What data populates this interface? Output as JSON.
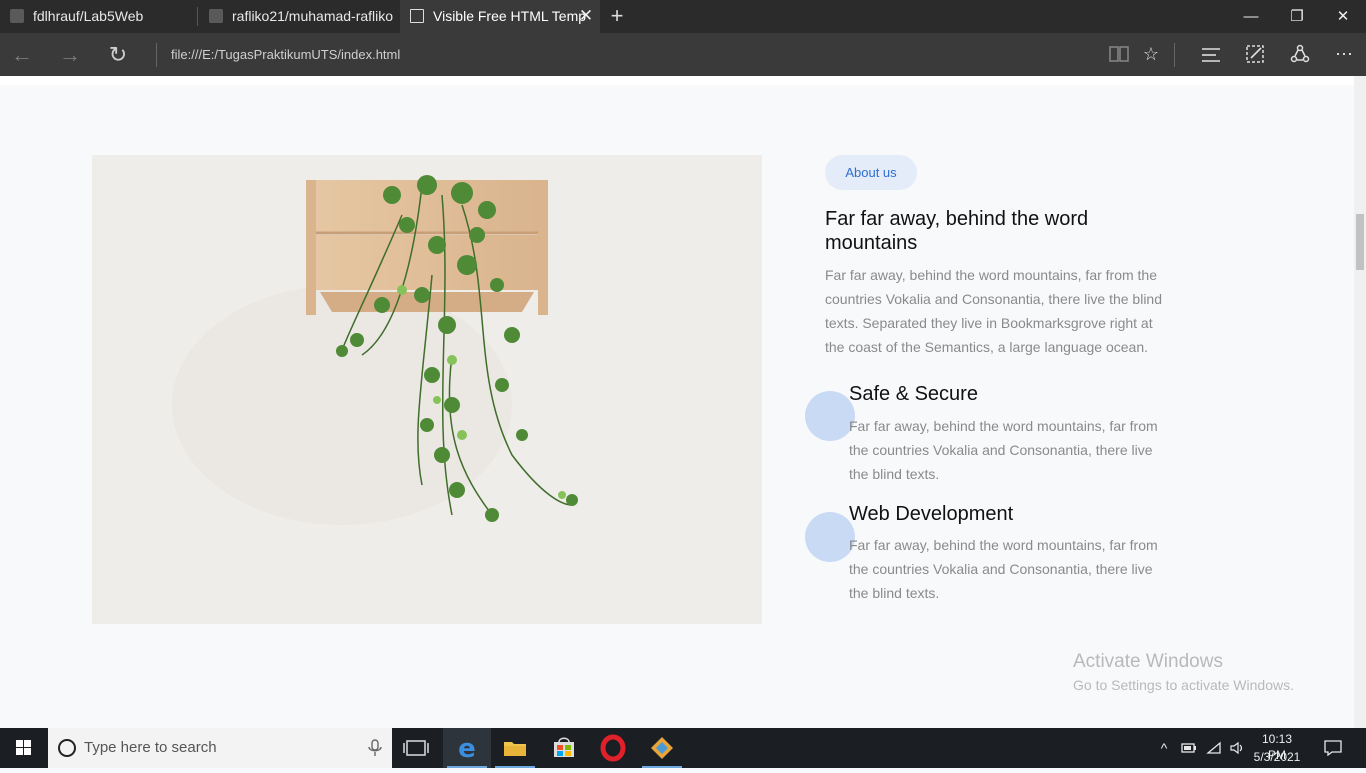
{
  "tabs": [
    {
      "title": "fdlhrauf/Lab5Web"
    },
    {
      "title": "rafliko21/muhamad-rafliko"
    },
    {
      "title": "Visible Free HTML Temp"
    }
  ],
  "address": {
    "url": "file:///E:/TugasPraktikumUTS/index.html"
  },
  "about": {
    "badge": "About us",
    "heading": "Far far away, behind the word mountains",
    "paragraph": "Far far away, behind the word mountains, far from the countries Vokalia and Consonantia, there live the blind texts. Separated they live in Bookmarksgrove right at the coast of the Semantics, a large language ocean."
  },
  "features": [
    {
      "title": "Safe & Secure",
      "text": "Far far away, behind the word mountains, far from the countries Vokalia and Consonantia, there live the blind texts."
    },
    {
      "title": "Web Development",
      "text": "Far far away, behind the word mountains, far from the countries Vokalia and Consonantia, there live the blind texts."
    }
  ],
  "watermark": {
    "line1": "Activate Windows",
    "line2": "Go to Settings to activate Windows."
  },
  "taskbar": {
    "search_placeholder": "Type here to search",
    "time": "10:13 PM",
    "date": "5/3/2021"
  },
  "colors": {
    "accent": "#2f6fd1",
    "badge_bg": "#e4ecf9",
    "feature_circle": "#c9daf5"
  }
}
